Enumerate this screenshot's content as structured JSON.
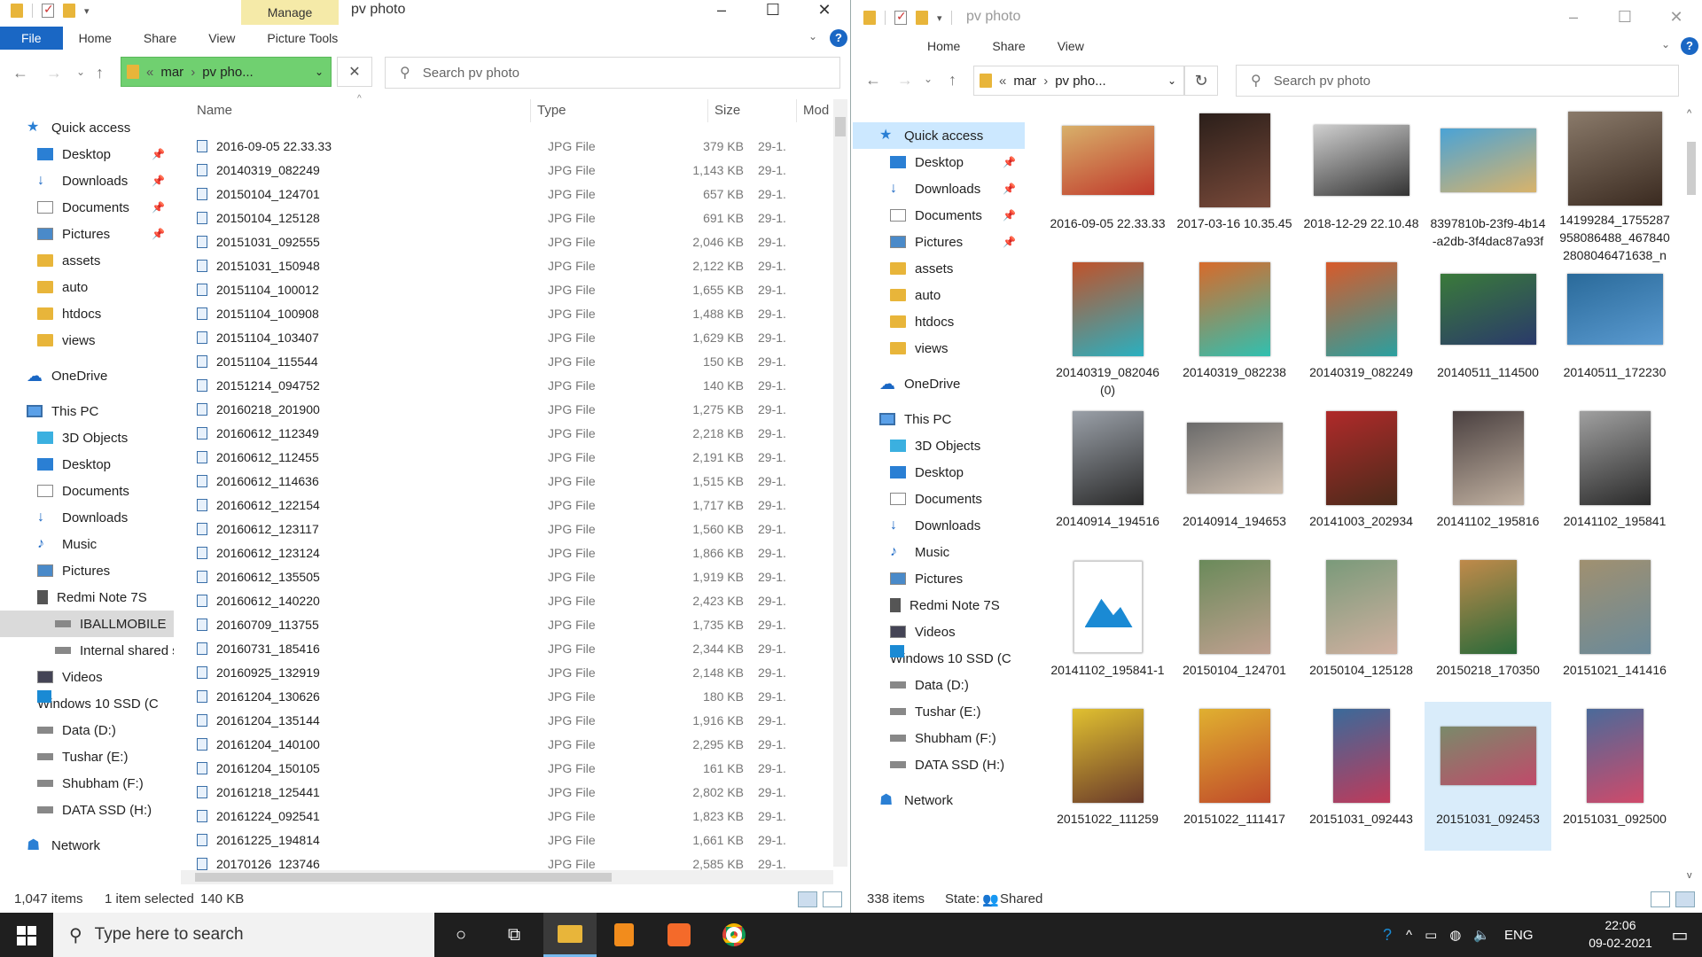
{
  "left": {
    "title": "pv photo",
    "manage_tab": "Manage",
    "tabs": [
      "File",
      "Home",
      "Share",
      "View",
      "Picture Tools"
    ],
    "path": {
      "prefix": "«",
      "seg1": "mar",
      "sep": "›",
      "seg2": "pv pho..."
    },
    "search_placeholder": "Search pv photo",
    "columns": {
      "name": "Name",
      "type": "Type",
      "size": "Size",
      "mod": "Mod"
    },
    "nav": [
      {
        "label": "Quick access",
        "icon": "star-icon",
        "indent": 0
      },
      {
        "label": "Desktop",
        "icon": "desktop-icon",
        "indent": 1,
        "pin": true
      },
      {
        "label": "Downloads",
        "icon": "download-icon",
        "indent": 1,
        "pin": true
      },
      {
        "label": "Documents",
        "icon": "documents-icon",
        "indent": 1,
        "pin": true
      },
      {
        "label": "Pictures",
        "icon": "pictures-icon",
        "indent": 1,
        "pin": true
      },
      {
        "label": "assets",
        "icon": "folder-icon",
        "indent": 1
      },
      {
        "label": "auto",
        "icon": "folder-icon",
        "indent": 1
      },
      {
        "label": "htdocs",
        "icon": "folder-icon",
        "indent": 1
      },
      {
        "label": "views",
        "icon": "folder-icon",
        "indent": 1
      },
      {
        "label": "OneDrive",
        "icon": "cloud-icon",
        "indent": 0,
        "gap": true
      },
      {
        "label": "This PC",
        "icon": "pc-icon",
        "indent": 0,
        "gap": true
      },
      {
        "label": "3D Objects",
        "icon": "cube-icon",
        "indent": 1
      },
      {
        "label": "Desktop",
        "icon": "desktop-icon",
        "indent": 1
      },
      {
        "label": "Documents",
        "icon": "documents-icon",
        "indent": 1
      },
      {
        "label": "Downloads",
        "icon": "download-icon",
        "indent": 1
      },
      {
        "label": "Music",
        "icon": "music-icon",
        "indent": 1
      },
      {
        "label": "Pictures",
        "icon": "pictures-icon",
        "indent": 1
      },
      {
        "label": "Redmi Note 7S",
        "icon": "phone-icon",
        "indent": 1
      },
      {
        "label": "IBALLMOBILE",
        "icon": "drive-icon",
        "indent": 2,
        "gsel": true
      },
      {
        "label": "Internal shared stc",
        "icon": "drive-icon",
        "indent": 2
      },
      {
        "label": "Videos",
        "icon": "videos-icon",
        "indent": 1
      },
      {
        "label": "Windows 10 SSD (C",
        "icon": "windows-drive-icon",
        "indent": 1
      },
      {
        "label": "Data (D:)",
        "icon": "drive-icon",
        "indent": 1
      },
      {
        "label": "Tushar (E:)",
        "icon": "drive-icon",
        "indent": 1
      },
      {
        "label": "Shubham (F:)",
        "icon": "drive-icon",
        "indent": 1
      },
      {
        "label": "DATA SSD (H:)",
        "icon": "drive-icon",
        "indent": 1
      },
      {
        "label": "Network",
        "icon": "network-icon",
        "indent": 0,
        "gap": true
      }
    ],
    "files": [
      {
        "name": "2016-09-05 22.33.33",
        "type": "JPG File",
        "size": "379 KB",
        "date": "29-1."
      },
      {
        "name": "20140319_082249",
        "type": "JPG File",
        "size": "1,143 KB",
        "date": "29-1."
      },
      {
        "name": "20150104_124701",
        "type": "JPG File",
        "size": "657 KB",
        "date": "29-1."
      },
      {
        "name": "20150104_125128",
        "type": "JPG File",
        "size": "691 KB",
        "date": "29-1."
      },
      {
        "name": "20151031_092555",
        "type": "JPG File",
        "size": "2,046 KB",
        "date": "29-1."
      },
      {
        "name": "20151031_150948",
        "type": "JPG File",
        "size": "2,122 KB",
        "date": "29-1."
      },
      {
        "name": "20151104_100012",
        "type": "JPG File",
        "size": "1,655 KB",
        "date": "29-1."
      },
      {
        "name": "20151104_100908",
        "type": "JPG File",
        "size": "1,488 KB",
        "date": "29-1."
      },
      {
        "name": "20151104_103407",
        "type": "JPG File",
        "size": "1,629 KB",
        "date": "29-1."
      },
      {
        "name": "20151104_115544",
        "type": "JPG File",
        "size": "150 KB",
        "date": "29-1."
      },
      {
        "name": "20151214_094752",
        "type": "JPG File",
        "size": "140 KB",
        "date": "29-1."
      },
      {
        "name": "20160218_201900",
        "type": "JPG File",
        "size": "1,275 KB",
        "date": "29-1."
      },
      {
        "name": "20160612_112349",
        "type": "JPG File",
        "size": "2,218 KB",
        "date": "29-1."
      },
      {
        "name": "20160612_112455",
        "type": "JPG File",
        "size": "2,191 KB",
        "date": "29-1."
      },
      {
        "name": "20160612_114636",
        "type": "JPG File",
        "size": "1,515 KB",
        "date": "29-1."
      },
      {
        "name": "20160612_122154",
        "type": "JPG File",
        "size": "1,717 KB",
        "date": "29-1."
      },
      {
        "name": "20160612_123117",
        "type": "JPG File",
        "size": "1,560 KB",
        "date": "29-1."
      },
      {
        "name": "20160612_123124",
        "type": "JPG File",
        "size": "1,866 KB",
        "date": "29-1."
      },
      {
        "name": "20160612_135505",
        "type": "JPG File",
        "size": "1,919 KB",
        "date": "29-1."
      },
      {
        "name": "20160612_140220",
        "type": "JPG File",
        "size": "2,423 KB",
        "date": "29-1."
      },
      {
        "name": "20160709_113755",
        "type": "JPG File",
        "size": "1,735 KB",
        "date": "29-1."
      },
      {
        "name": "20160731_185416",
        "type": "JPG File",
        "size": "2,344 KB",
        "date": "29-1."
      },
      {
        "name": "20160925_132919",
        "type": "JPG File",
        "size": "2,148 KB",
        "date": "29-1."
      },
      {
        "name": "20161204_130626",
        "type": "JPG File",
        "size": "180 KB",
        "date": "29-1."
      },
      {
        "name": "20161204_135144",
        "type": "JPG File",
        "size": "1,916 KB",
        "date": "29-1."
      },
      {
        "name": "20161204_140100",
        "type": "JPG File",
        "size": "2,295 KB",
        "date": "29-1."
      },
      {
        "name": "20161204_150105",
        "type": "JPG File",
        "size": "161 KB",
        "date": "29-1."
      },
      {
        "name": "20161218_125441",
        "type": "JPG File",
        "size": "2,802 KB",
        "date": "29-1."
      },
      {
        "name": "20161224_092541",
        "type": "JPG File",
        "size": "1,823 KB",
        "date": "29-1."
      },
      {
        "name": "20161225_194814",
        "type": "JPG File",
        "size": "1,661 KB",
        "date": "29-1."
      },
      {
        "name": "20170126_123746",
        "type": "JPG File",
        "size": "2,585 KB",
        "date": "29-1."
      }
    ],
    "status": {
      "count": "1,047 items",
      "selected": "1 item selected",
      "size": "140 KB"
    }
  },
  "right": {
    "title": "pv photo",
    "tabs": [
      "Home",
      "Share",
      "View"
    ],
    "path": {
      "prefix": "«",
      "seg1": "mar",
      "sep": "›",
      "seg2": "pv pho..."
    },
    "search_placeholder": "Search pv photo",
    "nav": [
      {
        "label": "Quick access",
        "icon": "star-icon",
        "indent": 0,
        "sel": true
      },
      {
        "label": "Desktop",
        "icon": "desktop-icon",
        "indent": 1,
        "pin": true
      },
      {
        "label": "Downloads",
        "icon": "download-icon",
        "indent": 1,
        "pin": true
      },
      {
        "label": "Documents",
        "icon": "documents-icon",
        "indent": 1,
        "pin": true
      },
      {
        "label": "Pictures",
        "icon": "pictures-icon",
        "indent": 1,
        "pin": true
      },
      {
        "label": "assets",
        "icon": "folder-icon",
        "indent": 1
      },
      {
        "label": "auto",
        "icon": "folder-icon",
        "indent": 1
      },
      {
        "label": "htdocs",
        "icon": "folder-icon",
        "indent": 1
      },
      {
        "label": "views",
        "icon": "folder-icon",
        "indent": 1
      },
      {
        "label": "OneDrive",
        "icon": "cloud-icon",
        "indent": 0,
        "gap": true
      },
      {
        "label": "This PC",
        "icon": "pc-icon",
        "indent": 0,
        "gap": true
      },
      {
        "label": "3D Objects",
        "icon": "cube-icon",
        "indent": 1
      },
      {
        "label": "Desktop",
        "icon": "desktop-icon",
        "indent": 1
      },
      {
        "label": "Documents",
        "icon": "documents-icon",
        "indent": 1
      },
      {
        "label": "Downloads",
        "icon": "download-icon",
        "indent": 1
      },
      {
        "label": "Music",
        "icon": "music-icon",
        "indent": 1
      },
      {
        "label": "Pictures",
        "icon": "pictures-icon",
        "indent": 1
      },
      {
        "label": "Redmi Note 7S",
        "icon": "phone-icon",
        "indent": 1
      },
      {
        "label": "Videos",
        "icon": "videos-icon",
        "indent": 1
      },
      {
        "label": "Windows 10 SSD (C",
        "icon": "windows-drive-icon",
        "indent": 1
      },
      {
        "label": "Data (D:)",
        "icon": "drive-icon",
        "indent": 1
      },
      {
        "label": "Tushar (E:)",
        "icon": "drive-icon",
        "indent": 1
      },
      {
        "label": "Shubham (F:)",
        "icon": "drive-icon",
        "indent": 1
      },
      {
        "label": "DATA SSD (H:)",
        "icon": "drive-icon",
        "indent": 1
      },
      {
        "label": "Network",
        "icon": "network-icon",
        "indent": 0,
        "gap": true
      }
    ],
    "tiles": [
      {
        "caption": "2016-09-05 22.33.33",
        "w": 104,
        "h": 78,
        "c1": "#d8b06a",
        "c2": "#c0392b"
      },
      {
        "caption": "2017-03-16 10.35.45",
        "w": 80,
        "h": 106,
        "c1": "#2b1f1a",
        "c2": "#7a4a3a"
      },
      {
        "caption": "2018-12-29 22.10.48",
        "w": 108,
        "h": 80,
        "c1": "#cfcfcf",
        "c2": "#333333"
      },
      {
        "caption": "8397810b-23f9-4b14-a2db-3f4dac87a93f",
        "w": 108,
        "h": 72,
        "c1": "#4aa3d6",
        "c2": "#d9b36a"
      },
      {
        "caption": "14199284_1755287958086488_4678402808046471638_n",
        "w": 106,
        "h": 106,
        "c1": "#8a7a6a",
        "c2": "#3a2a20"
      },
      {
        "caption": "20140319_082046(0)",
        "w": 80,
        "h": 106,
        "c1": "#c0522a",
        "c2": "#2ab0c0"
      },
      {
        "caption": "20140319_082238",
        "w": 80,
        "h": 106,
        "c1": "#d86a2a",
        "c2": "#30c0b0"
      },
      {
        "caption": "20140319_082249",
        "w": 80,
        "h": 106,
        "c1": "#d85a2a",
        "c2": "#2aa0a0"
      },
      {
        "caption": "20140511_114500",
        "w": 108,
        "h": 80,
        "c1": "#3a7a3a",
        "c2": "#2a3a6a"
      },
      {
        "caption": "20140511_172230",
        "w": 108,
        "h": 80,
        "c1": "#2a6a9a",
        "c2": "#5a9ad0"
      },
      {
        "caption": "20140914_194516",
        "w": 80,
        "h": 106,
        "c1": "#9aa0a8",
        "c2": "#2a2a2a"
      },
      {
        "caption": "20140914_194653",
        "w": 108,
        "h": 80,
        "c1": "#6a6a6a",
        "c2": "#d0c0b0"
      },
      {
        "caption": "20141003_202934",
        "w": 80,
        "h": 106,
        "c1": "#b02a2a",
        "c2": "#4a2a1a"
      },
      {
        "caption": "20141102_195816",
        "w": 80,
        "h": 106,
        "c1": "#4a4040",
        "c2": "#c0b0a0"
      },
      {
        "caption": "20141102_195841",
        "w": 80,
        "h": 106,
        "c1": "#a0a0a0",
        "c2": "#2a2a2a"
      },
      {
        "caption": "20141102_195841-1",
        "w": 78,
        "h": 104,
        "c1": "#ffffff",
        "c2": "#1a8ad4",
        "generic": true
      },
      {
        "caption": "20150104_124701",
        "w": 80,
        "h": 106,
        "c1": "#6a8a5a",
        "c2": "#c0a090"
      },
      {
        "caption": "20150104_125128",
        "w": 80,
        "h": 106,
        "c1": "#7a9a7a",
        "c2": "#d0b0a0"
      },
      {
        "caption": "20150218_170350",
        "w": 64,
        "h": 106,
        "c1": "#c08a4a",
        "c2": "#2a6a3a"
      },
      {
        "caption": "20151021_141416",
        "w": 80,
        "h": 106,
        "c1": "#a09070",
        "c2": "#6a8a9a"
      },
      {
        "caption": "20151022_111259",
        "w": 80,
        "h": 106,
        "c1": "#e0c030",
        "c2": "#6a3a2a"
      },
      {
        "caption": "20151022_111417",
        "w": 80,
        "h": 106,
        "c1": "#e0b030",
        "c2": "#c04a2a"
      },
      {
        "caption": "20151031_092443",
        "w": 64,
        "h": 106,
        "c1": "#3a6a9a",
        "c2": "#c03a5a"
      },
      {
        "caption": "20151031_092453",
        "w": 108,
        "h": 66,
        "c1": "#7a8a6a",
        "c2": "#c04a6a",
        "sel": true
      },
      {
        "caption": "20151031_092500",
        "w": 64,
        "h": 106,
        "c1": "#4a6a9a",
        "c2": "#d04a6a"
      }
    ],
    "status": {
      "count": "338 items",
      "state_label": "State:",
      "state_value": "Shared"
    }
  },
  "taskbar": {
    "search_placeholder": "Type here to search",
    "lang": "ENG",
    "time": "22:06",
    "date": "09-02-2021"
  }
}
